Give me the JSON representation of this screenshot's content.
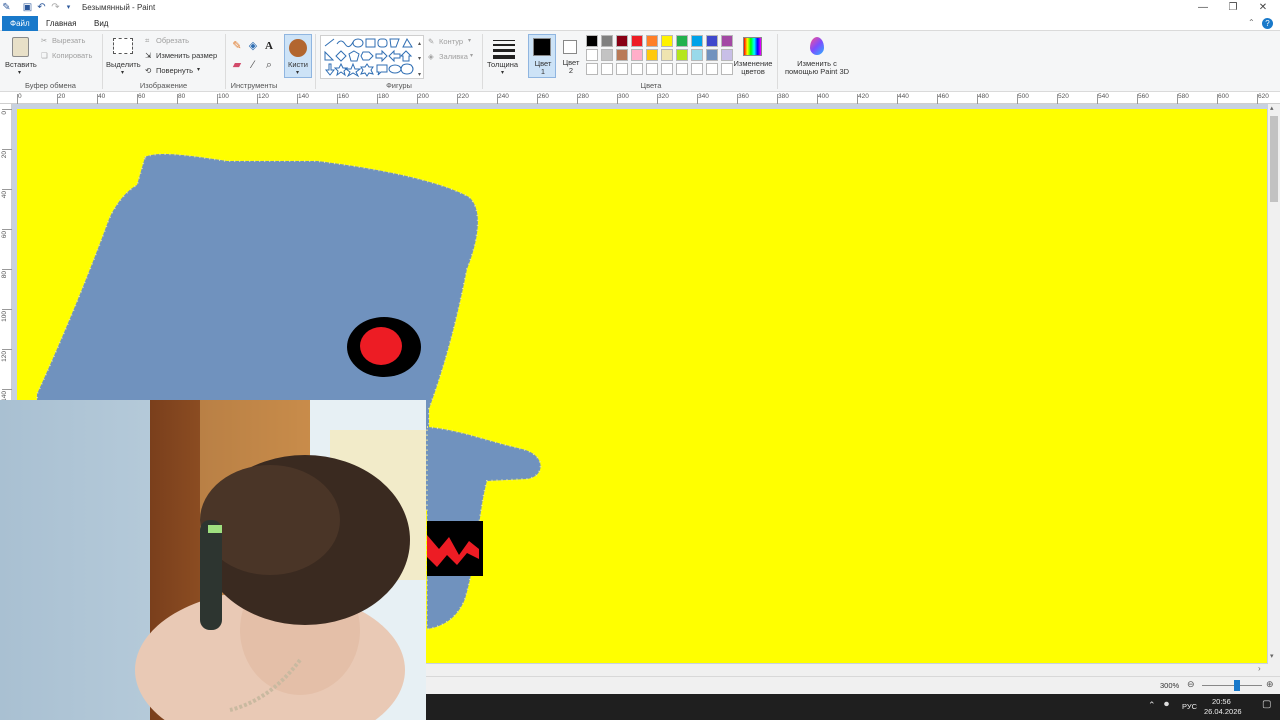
{
  "window": {
    "title": "Безымянный - Paint"
  },
  "quick_access": {
    "icons": [
      "paint-app-icon",
      "save-icon",
      "undo-icon",
      "redo-icon",
      "customize-icon"
    ]
  },
  "tabs": {
    "file": "Файл",
    "home": "Главная",
    "view": "Вид"
  },
  "clipboard": {
    "paste": "Вставить",
    "cut": "Вырезать",
    "copy": "Копировать",
    "label": "Буфер обмена"
  },
  "image": {
    "select": "Выделить",
    "crop": "Обрезать",
    "resize": "Изменить размер",
    "rotate": "Повернуть",
    "label": "Изображение"
  },
  "tools": {
    "label": "Инструменты"
  },
  "brushes": {
    "label": "Кисти"
  },
  "shapes": {
    "outline": "Контур",
    "fill": "Заливка",
    "label": "Фигуры"
  },
  "size": {
    "label": "Толщина"
  },
  "colors": {
    "color1": "Цвет 1",
    "color2": "Цвет 2",
    "label": "Цвета",
    "edit": "Изменение цветов",
    "paint3d": "Изменить с помощью Paint 3D",
    "palette_row1": [
      "#000000",
      "#7f7f7f",
      "#880015",
      "#ed1c24",
      "#ff7f27",
      "#fff200",
      "#22b14c",
      "#00a2e8",
      "#3f48cc",
      "#a349a4"
    ],
    "palette_row2": [
      "#ffffff",
      "#c3c3c3",
      "#b97a57",
      "#ffaec9",
      "#ffc90e",
      "#efe4b0",
      "#b5e61d",
      "#99d9ea",
      "#7092be",
      "#c8bfe7"
    ],
    "color1_value": "#000000",
    "color2_value": "#ffffff"
  },
  "ruler_h": [
    "0",
    "20",
    "40",
    "60",
    "80",
    "100",
    "120",
    "140",
    "160",
    "180",
    "200",
    "220",
    "240",
    "260",
    "280",
    "300",
    "320",
    "340",
    "360",
    "380",
    "400",
    "420",
    "440",
    "460",
    "480",
    "500",
    "520",
    "540",
    "560",
    "580",
    "600",
    "620"
  ],
  "ruler_v": [
    "0",
    "20",
    "40",
    "60",
    "80",
    "100",
    "120",
    "140"
  ],
  "canvas": {
    "background": "#ffff00",
    "shape_color": "#7092be"
  },
  "status": {
    "zoom": "300%"
  },
  "taskbar": {
    "lang": "РУС",
    "time": "20:56",
    "date": "26.04.2026"
  }
}
